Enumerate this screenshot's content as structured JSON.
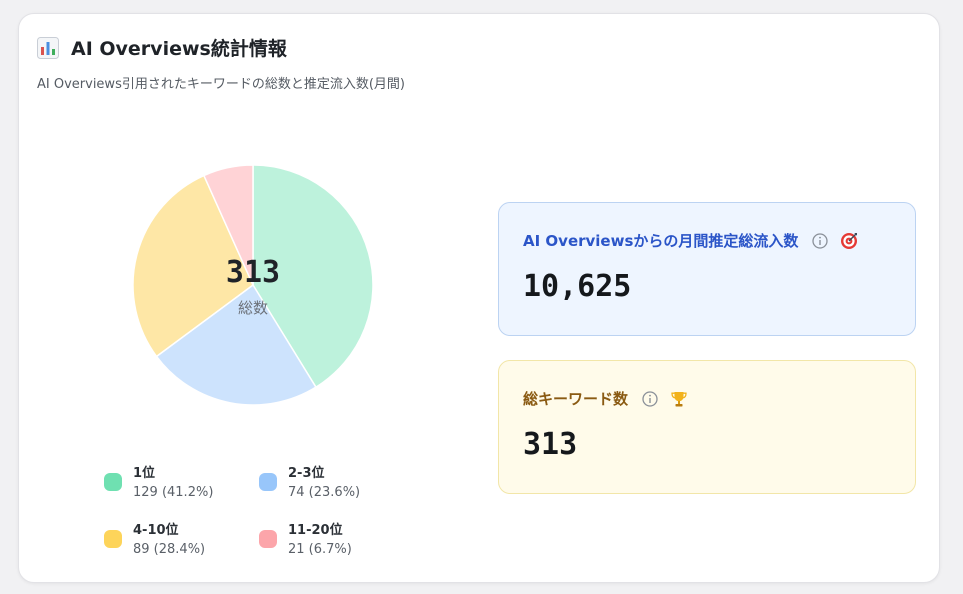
{
  "header": {
    "icon": "bar-chart-icon",
    "title": "AI Overviews統計情報",
    "subtitle": "AI Overviews引用されたキーワードの総数と推定流入数(月間)"
  },
  "chart_data": {
    "type": "pie",
    "total": "313",
    "total_label": "総数",
    "categories": [
      "1位",
      "2-3位",
      "4-10位",
      "11-20位"
    ],
    "values": [
      129,
      74,
      89,
      21
    ],
    "percentages": [
      "41.2%",
      "23.6%",
      "28.4%",
      "6.7%"
    ],
    "slice_colors": [
      "#bdf2dc",
      "#cde3fd",
      "#fee7a6",
      "#ffd3d6"
    ],
    "legend_colors": [
      "#6fe0b1",
      "#98c6fa",
      "#fdd45a",
      "#fca5aa"
    ],
    "legend_placement": "bottom"
  },
  "legend": {
    "items": [
      {
        "label": "1位",
        "value_text": "129 (41.2%)"
      },
      {
        "label": "2-3位",
        "value_text": "74 (23.6%)"
      },
      {
        "label": "4-10位",
        "value_text": "89 (28.4%)"
      },
      {
        "label": "11-20位",
        "value_text": "21 (6.7%)"
      }
    ]
  },
  "stats": {
    "traffic": {
      "label": "AI Overviewsからの月間推定総流入数",
      "value": "10,625",
      "icons": [
        "info-icon",
        "target-icon"
      ],
      "accent": "#2b55c8"
    },
    "keywords": {
      "label": "総キーワード数",
      "value": "313",
      "icons": [
        "info-icon",
        "trophy-icon"
      ],
      "accent": "#8a5a12"
    }
  }
}
